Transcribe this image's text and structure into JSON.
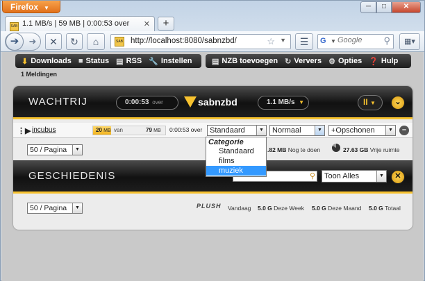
{
  "browser": {
    "menu_label": "Firefox",
    "tab_title": "1.1 MB/s | 59 MB | 0:00:53 over",
    "url": "http://localhost:8080/sabnzbd/",
    "search_placeholder": "Google",
    "newtab_label": "+"
  },
  "nav": {
    "items": [
      {
        "label": "Downloads",
        "icon": "download-icon"
      },
      {
        "label": "Status",
        "icon": "status-icon"
      },
      {
        "label": "RSS",
        "icon": "rss-icon"
      },
      {
        "label": "Instellen",
        "icon": "wrench-icon"
      }
    ],
    "right_items": [
      {
        "label": "NZB toevoegen",
        "icon": "add-file-icon"
      },
      {
        "label": "Ververs",
        "icon": "refresh-icon"
      },
      {
        "label": "Opties",
        "icon": "gear-icon"
      },
      {
        "label": "Hulp",
        "icon": "help-icon"
      }
    ]
  },
  "notifications": "1 Meldingen",
  "queue": {
    "title": "WACHTRIJ",
    "timeleft": "0:00:53",
    "timeleft_suffix": "over",
    "logo_text": "sabnzbd",
    "speed": "1.1 MB/s",
    "pause_label": "II",
    "job": {
      "name": "incubus",
      "downloaded": "20",
      "downloaded_unit": "MB",
      "van": "van",
      "total": "79",
      "total_unit": "MB",
      "progress_fraction": 0.25,
      "timeleft": "0:00:53 over",
      "category": "Standaard",
      "priority": "Normaal",
      "options": "+Opschonen"
    },
    "per_page": "50 / Pagina",
    "remaining": ".82 MB",
    "remaining_label": "Nog te doen",
    "free": "27.63 GB",
    "free_label": "Vrije ruimte"
  },
  "category_menu": {
    "header": "Categorie",
    "options": [
      "Standaard",
      "films",
      "muziek"
    ],
    "highlighted": "muziek"
  },
  "history": {
    "title": "GESCHIEDENIS",
    "search_value": "",
    "filter": "Toon Alles",
    "per_page": "50 / Pagina",
    "brand": "PLUSH",
    "stats": [
      {
        "value": "",
        "label": "Vandaag"
      },
      {
        "value": "5.0 G",
        "label": "Deze Week"
      },
      {
        "value": "5.0 G",
        "label": "Deze Maand"
      },
      {
        "value": "5.0 G",
        "label": "Totaal"
      }
    ]
  },
  "colors": {
    "accent": "#f7c22f",
    "panel": "#1e1e1e",
    "highlight": "#3399ff"
  }
}
